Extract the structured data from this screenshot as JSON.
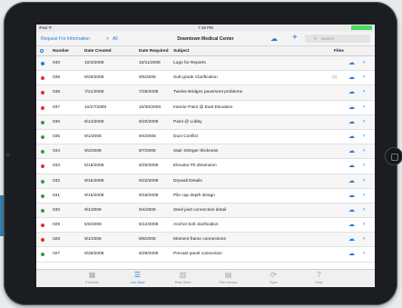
{
  "status": {
    "carrier": "iPad ᯤ",
    "time": "7:18 PM",
    "battery": "100%"
  },
  "nav": {
    "back_label": "Request For Information",
    "separator": ">",
    "all_label": "All",
    "title": "Downtown Medical Center",
    "search_placeholder": "Search"
  },
  "columns": {
    "number": "Number",
    "created": "Date Created",
    "required": "Date Required",
    "subject": "Subject",
    "files": "Files"
  },
  "colors": {
    "blue": "#2a7ad5",
    "red": "#e0302d",
    "green": "#2e9e3e"
  },
  "rows": [
    {
      "dot": "blue",
      "number": "040",
      "created": "10/4/2008",
      "required": "10/11/2008",
      "subject": "Logo for Reports",
      "attachments": ""
    },
    {
      "dot": "red",
      "number": "039",
      "created": "8/29/2008",
      "required": "9/5/2008",
      "subject": "Sub-grade Clarification",
      "attachments": "(2)"
    },
    {
      "dot": "red",
      "number": "038",
      "created": "7/21/2008",
      "required": "7/28/2008",
      "subject": "Twelve Bridges pavement problems",
      "attachments": ""
    },
    {
      "dot": "red",
      "number": "037",
      "created": "10/27/2008",
      "required": "10/30/2008",
      "subject": "Interior Paint @ East Elevation",
      "attachments": ""
    },
    {
      "dot": "green",
      "number": "036",
      "created": "8/14/2008",
      "required": "8/20/2008",
      "subject": "Paint @ Lobby",
      "attachments": ""
    },
    {
      "dot": "green",
      "number": "035",
      "created": "9/1/2008",
      "required": "9/4/2008",
      "subject": "Duct Conflict",
      "attachments": ""
    },
    {
      "dot": "green",
      "number": "034",
      "created": "9/2/2008",
      "required": "9/7/2008",
      "subject": "Stair Stringer thickness",
      "attachments": ""
    },
    {
      "dot": "red",
      "number": "033",
      "created": "6/18/2008",
      "required": "6/25/2008",
      "subject": "Elevator Pit dimension",
      "attachments": ""
    },
    {
      "dot": "green",
      "number": "032",
      "created": "9/15/2008",
      "required": "9/22/2008",
      "subject": "Drywall Details",
      "attachments": ""
    },
    {
      "dot": "green",
      "number": "031",
      "created": "9/15/2008",
      "required": "9/18/2008",
      "subject": "Pile cap depth design",
      "attachments": ""
    },
    {
      "dot": "green",
      "number": "030",
      "created": "9/1/2008",
      "required": "9/4/2008",
      "subject": "Steel joist connection detail",
      "attachments": ""
    },
    {
      "dot": "red",
      "number": "029",
      "created": "5/6/2008",
      "required": "5/13/2008",
      "subject": "Anchor bolt clarification",
      "attachments": ""
    },
    {
      "dot": "red",
      "number": "028",
      "created": "9/1/2008",
      "required": "9/8/2008",
      "subject": "Moment frame connections",
      "attachments": ""
    },
    {
      "dot": "green",
      "number": "027",
      "created": "8/29/2008",
      "required": "8/29/2008",
      "subject": "Precast panel connection",
      "attachments": ""
    }
  ],
  "tabs": [
    {
      "label": "Portfolio",
      "icon": "building-icon"
    },
    {
      "label": "List View",
      "icon": "list-icon",
      "active": true
    },
    {
      "label": "Plan View",
      "icon": "map-icon"
    },
    {
      "label": "File Library",
      "icon": "file-icon"
    },
    {
      "label": "Sync",
      "icon": "sync-icon"
    },
    {
      "label": "Help",
      "icon": "help-icon"
    }
  ]
}
